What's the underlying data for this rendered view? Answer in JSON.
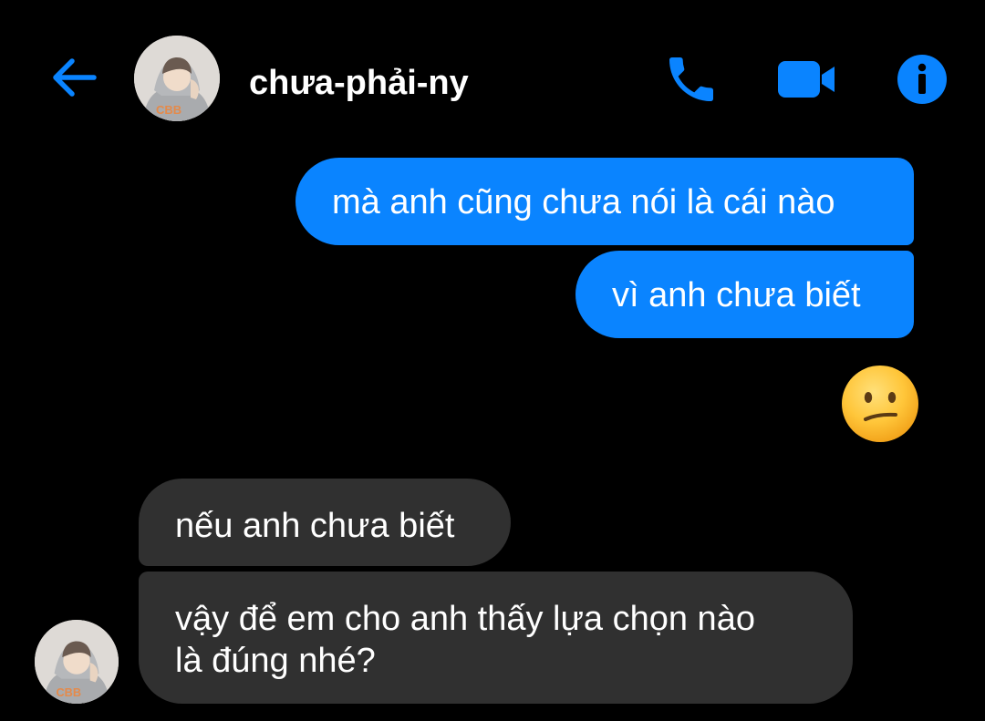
{
  "header": {
    "contact_name": "chưa-phải-ny",
    "icons": {
      "back": "back-arrow-icon",
      "call": "phone-icon",
      "video": "video-camera-icon",
      "info": "info-icon"
    },
    "accent_color": "#0a84ff"
  },
  "messages": [
    {
      "direction": "outgoing",
      "text": "mà anh cũng chưa nói là cái nào"
    },
    {
      "direction": "outgoing",
      "text": "vì anh chưa biết"
    },
    {
      "direction": "outgoing",
      "type": "emoji",
      "emoji_name": "confused-face-emoji"
    },
    {
      "direction": "incoming",
      "text": "nếu anh chưa biết"
    },
    {
      "direction": "incoming",
      "lines": [
        "vậy để em cho anh thấy lựa chọn nào",
        "là đúng nhé?"
      ]
    }
  ],
  "colors": {
    "background": "#000000",
    "outgoing_bubble": "#0a84ff",
    "incoming_bubble": "#303030",
    "text": "#ffffff"
  }
}
